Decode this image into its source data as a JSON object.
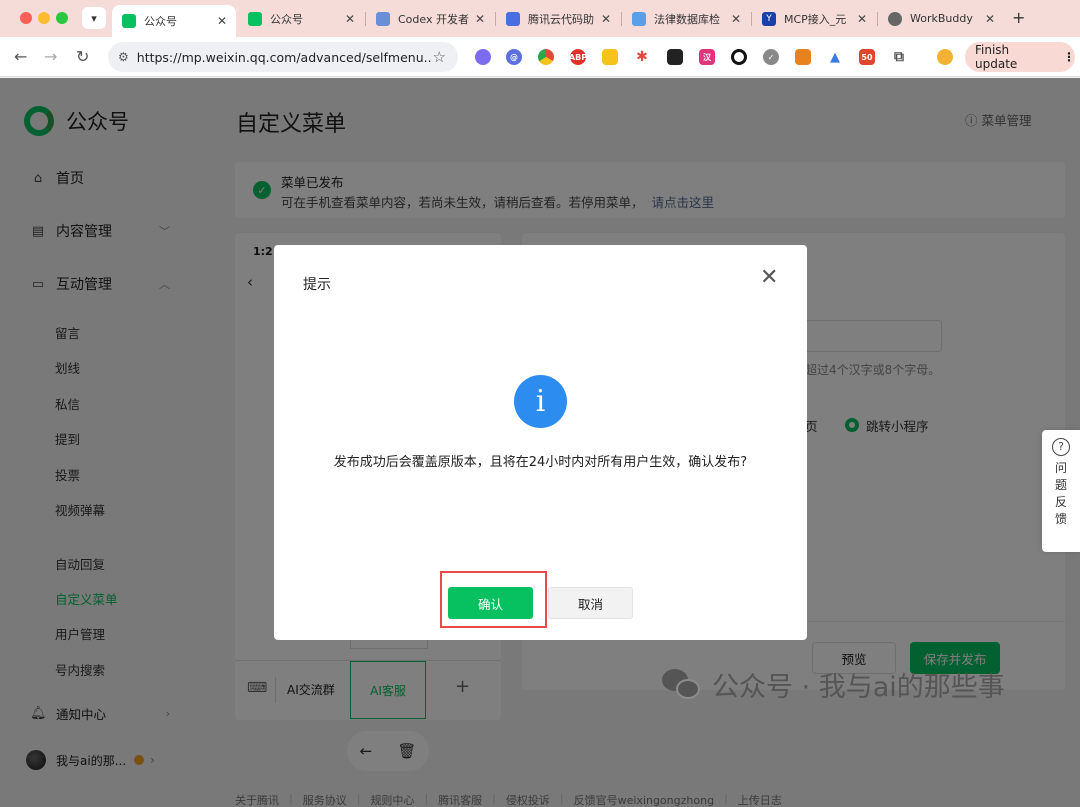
{
  "browser": {
    "tabs": [
      {
        "title": "公众号",
        "fav_color": "#07c160",
        "active": true
      },
      {
        "title": "公众号",
        "fav_color": "#07c160"
      },
      {
        "title": "Codex 开发者",
        "fav_color": "#6a8fd8"
      },
      {
        "title": "腾讯云代码助",
        "fav_color": "#4a6ee0"
      },
      {
        "title": "法律数据库检",
        "fav_color": "#5aa0e8"
      },
      {
        "title": "MCP接入_元",
        "fav_color": "#1a3fa8"
      },
      {
        "title": "WorkBuddy",
        "fav_color": "#666666"
      }
    ],
    "url": "https://mp.weixin.qq.com/advanced/selfmenu...",
    "finish_update": "Finish update",
    "extensions": [
      {
        "name": "robot-ext-icon",
        "color": "#7b6cf0",
        "label": ""
      },
      {
        "name": "at-ext-icon",
        "color": "#5b6fe0",
        "label": ""
      },
      {
        "name": "chrome-ext-icon",
        "color": "#e04b3a",
        "label": ""
      },
      {
        "name": "abp-ext-icon",
        "color": "#e0312b",
        "label": "ABP"
      },
      {
        "name": "keep-ext-icon",
        "color": "#f6c21b",
        "label": ""
      },
      {
        "name": "spark-ext-icon",
        "color": "#e8453c",
        "label": ""
      },
      {
        "name": "tick-ext-icon",
        "color": "#222222",
        "label": ""
      },
      {
        "name": "translate-ext-icon",
        "color": "#e2347c",
        "label": ""
      },
      {
        "name": "ring-ext-icon",
        "color": "#111111",
        "label": ""
      },
      {
        "name": "check-ext-icon",
        "color": "#888888",
        "label": ""
      },
      {
        "name": "fox-ext-icon",
        "color": "#e8821e",
        "label": ""
      },
      {
        "name": "arrow-ext-icon",
        "color": "#3a7be0",
        "label": ""
      },
      {
        "name": "badge-ext-icon",
        "color": "#e0462b",
        "label": "50"
      },
      {
        "name": "puzzle-ext-icon",
        "color": "#555555",
        "label": ""
      }
    ]
  },
  "sidebar": {
    "brand": "公众号",
    "items": [
      {
        "label": "首页",
        "icon": "home-icon"
      },
      {
        "label": "内容管理",
        "icon": "doc-icon"
      },
      {
        "label": "互动管理",
        "icon": "chat-icon"
      }
    ],
    "interaction_sub": [
      "留言",
      "划线",
      "私信",
      "提到",
      "投票",
      "视频弹幕"
    ],
    "function_sub": [
      "自动回复",
      "自定义菜单",
      "用户管理",
      "号内搜索"
    ],
    "notify": "通知中心",
    "user": "我与ai的那..."
  },
  "main": {
    "title": "自定义菜单",
    "menu_manage": "菜单管理",
    "notice_title": "菜单已发布",
    "notice_text": "可在手机查看菜单内容，若尚未生效，请稍后查看。若停用菜单，",
    "notice_link": "请点击这里",
    "phone_time": "1:21",
    "menu_items": [
      "AI交流群",
      "AI客服"
    ],
    "hint": "超过4个汉字或8个字母。",
    "option_a": "页",
    "option_b": "跳转小程序",
    "preview": "预览",
    "save_publish": "保存并发布"
  },
  "feedback": "问题反馈",
  "footer_links": [
    "关于腾讯",
    "服务协议",
    "规则中心",
    "腾讯客服",
    "侵权投诉",
    "反馈官号weixingongzhong",
    "上传日志"
  ],
  "watermark": "公众号 · 我与ai的那些事",
  "dialog": {
    "title": "提示",
    "message": "发布成功后会覆盖原版本，且将在24小时内对所有用户生效，确认发布?",
    "confirm": "确认",
    "cancel": "取消"
  }
}
